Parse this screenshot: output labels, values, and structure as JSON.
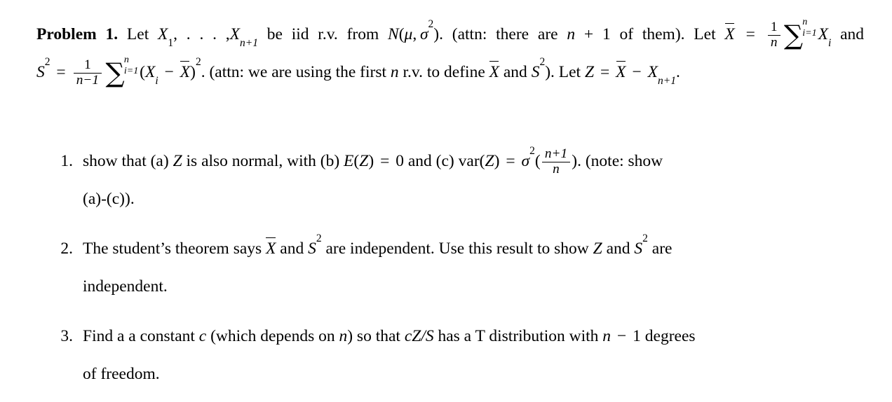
{
  "document": {
    "type": "math-homework-problem",
    "background_color": "#ffffff",
    "text_color": "#000000"
  },
  "statement": {
    "label": "Problem 1.",
    "line1_a": "Let",
    "var_x": "X",
    "sub_1": "1",
    "comma_dots": ", . . . ,",
    "sub_n_plus_1": "n+1",
    "line1_b": "be iid r.v.  from",
    "normal_N": "N",
    "mu": "μ",
    "sigma": "σ",
    "exp_2": "2",
    "attn_1": "(attn:  there are",
    "n": "n",
    "plus": "+",
    "one": "1",
    "attn_1_end": "of them).",
    "let_2": "Let",
    "xbar": "X",
    "equals": "=",
    "frac_1_num": "1",
    "frac_1_den": "n",
    "sigma_upper": "n",
    "sigma_lower": "i=1",
    "sub_i": "i",
    "and": "and",
    "S": "S",
    "S_exp": "2",
    "frac_2_num": "1",
    "frac_2_den": "n−1",
    "minus": "−",
    "paren_open": "(",
    "paren_close": ")",
    "sq": "2",
    "period": ".",
    "attn_2": "(attn:  we are using the first",
    "attn_2_b": "r.v.  to define",
    "attn_2_c": "and",
    "close_paren": ").",
    "let_3": "Let",
    "Z": "Z",
    "minus_sign": "−",
    "end_period": "."
  },
  "items": [
    {
      "marker": "1.",
      "text_a": "show that (a)",
      "Z": "Z",
      "text_b": "is also normal, with (b)",
      "E": "E",
      "equals": "=",
      "zero": "0",
      "text_c": "and (c)",
      "var": "var",
      "sigma": "σ",
      "sigma_exp": "2",
      "frac_num": "n+1",
      "frac_den": "n",
      "note": "(note:  show",
      "line2": "(a)-(c))."
    },
    {
      "marker": "2.",
      "text_a": "The student’s theorem says",
      "xbar": "X",
      "text_b": "and",
      "S": "S",
      "S_exp": "2",
      "text_c": "are independent.  Use this result to show",
      "Z": "Z",
      "text_d": "and",
      "text_e": "are",
      "line2": "independent."
    },
    {
      "marker": "3.",
      "text_a": "Find a a constant",
      "c": "c",
      "text_b": "(which depends on",
      "n": "n",
      "text_c": ") so that",
      "cZS": "cZ/S",
      "text_d": "has a T distribution with",
      "minus": "−",
      "one": "1",
      "text_e": "degrees",
      "line2": "of freedom."
    }
  ]
}
